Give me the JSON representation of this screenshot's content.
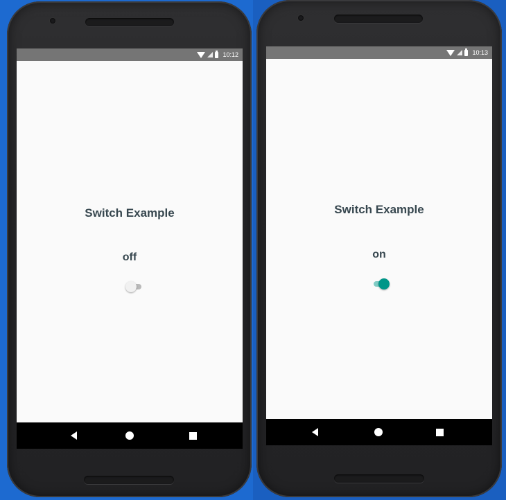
{
  "phones": [
    {
      "status_bar": {
        "time": "10:12"
      },
      "title": "Switch Example",
      "state_text": "off",
      "switch": {
        "checked": false
      }
    },
    {
      "status_bar": {
        "time": "10:13"
      },
      "title": "Switch Example",
      "state_text": "on",
      "switch": {
        "checked": true
      }
    }
  ],
  "colors": {
    "accent": "#009688",
    "track_on": "#80cbc4",
    "status_bar": "#757575",
    "nav_bar": "#000000",
    "text": "#37474f"
  },
  "icons": {
    "status": [
      "wifi-icon",
      "signal-icon",
      "battery-icon"
    ],
    "nav": [
      "back-icon",
      "home-icon",
      "recents-icon"
    ]
  }
}
